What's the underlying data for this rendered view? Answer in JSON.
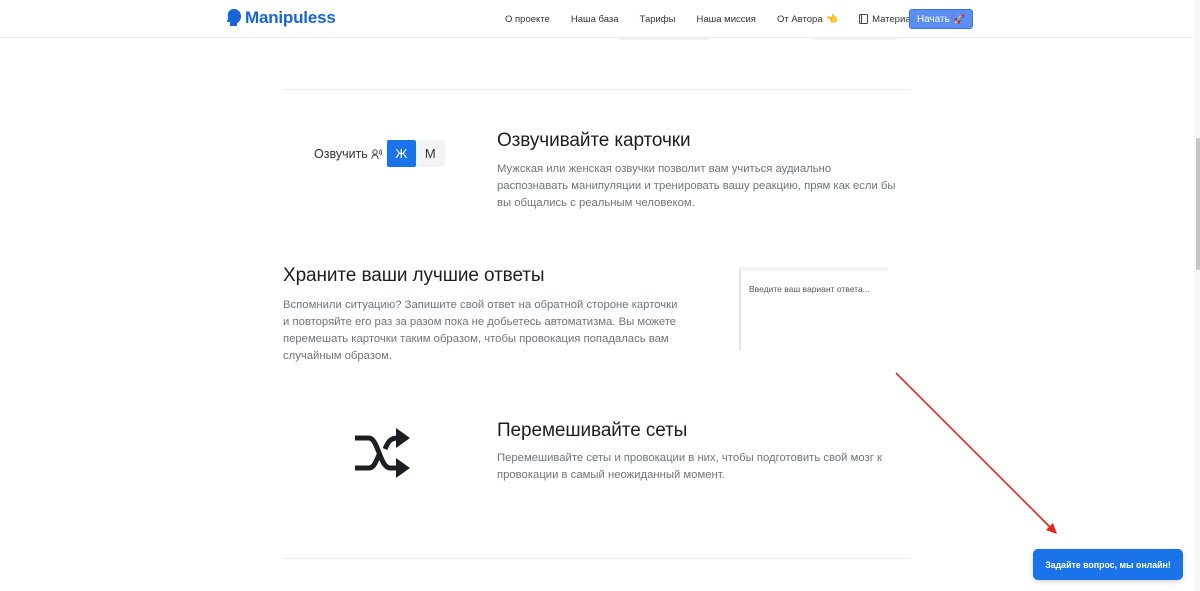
{
  "header": {
    "logo_text": "Manipuless",
    "nav": [
      {
        "label": "О проекте"
      },
      {
        "label": "Наша база"
      },
      {
        "label": "Тарифы"
      },
      {
        "label": "Наша миссия"
      },
      {
        "label": "От Автора",
        "emoji": "👈"
      },
      {
        "label": "Материалы",
        "icon": "book-icon"
      }
    ],
    "start_button": {
      "label": "Начать",
      "emoji": "🚀"
    }
  },
  "voice_section": {
    "widget_label": "Озвучить",
    "female_label": "Ж",
    "male_label": "М",
    "selected": "Ж",
    "title": "Озвучивайте карточки",
    "description": "Мужская или женская озвучки позволит вам учиться аудиально распознавать манипуляции и тренировать вашу реакцию, прям как если бы вы общались с реальным человеком."
  },
  "answers_section": {
    "title": "Храните ваши лучшие ответы",
    "description": "Вспомнили ситуацию? Запишите свой ответ на обратной стороне карточки и повторяйте его раз за разом пока не добьетесь автоматизма. Вы можете перемешать карточки таким образом, чтобы провокация попадалась вам случайным образом.",
    "input_placeholder": "Введите ваш вариант ответа..."
  },
  "shuffle_section": {
    "title": "Перемешивайте сеты",
    "description": "Перемешивайте сеты и провокации в них, чтобы подготовить свой мозг к провокации в самый неожиданный момент.",
    "icon": "shuffle-icon"
  },
  "chat_button": {
    "label": "Задайте вопрос, мы онлайн!"
  },
  "colors": {
    "accent": "#1a73e8",
    "logo": "#1766d6",
    "annotation": "#e8221b"
  }
}
